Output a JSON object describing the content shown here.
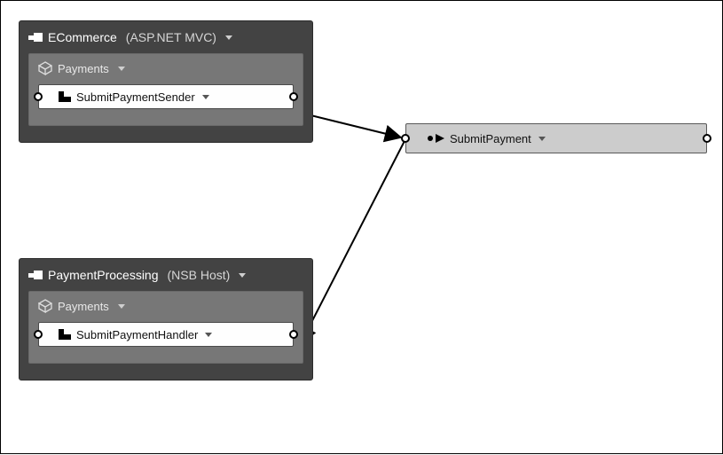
{
  "endpoints": [
    {
      "name": "ECommerce",
      "subtitle": "(ASP.NET MVC)",
      "package": {
        "name": "Payments",
        "component": {
          "name": "SubmitPaymentSender"
        }
      }
    },
    {
      "name": "PaymentProcessing",
      "subtitle": "(NSB Host)",
      "package": {
        "name": "Payments",
        "component": {
          "name": "SubmitPaymentHandler"
        }
      }
    }
  ],
  "message": {
    "name": "SubmitPayment"
  }
}
